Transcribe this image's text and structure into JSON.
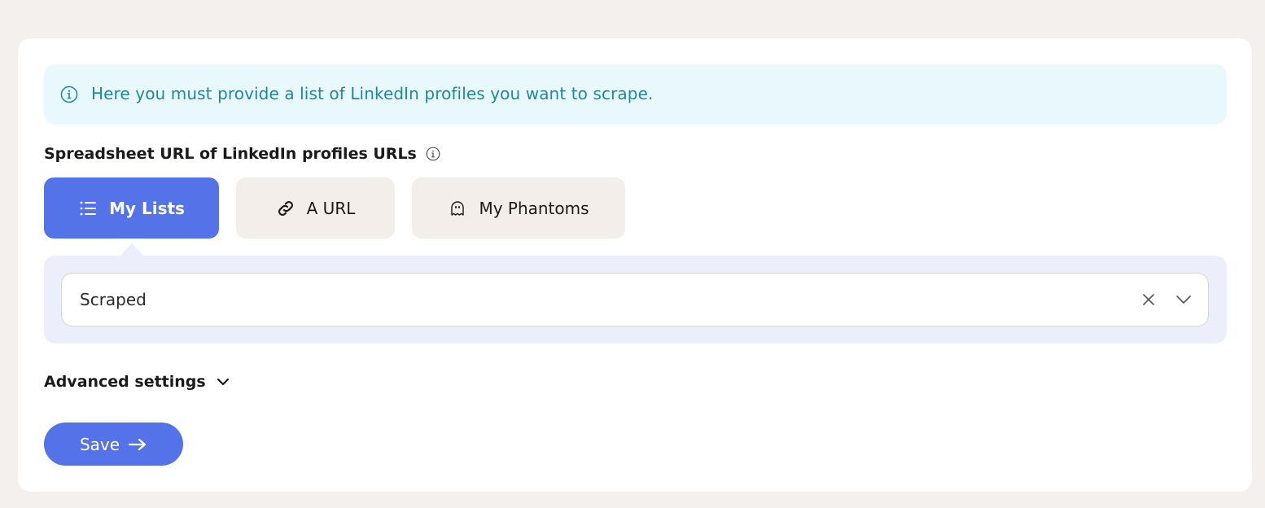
{
  "info_banner": {
    "icon": "info-circle-icon",
    "text": "Here you must provide a list of LinkedIn profiles you want to scrape."
  },
  "field": {
    "label": "Spreadsheet URL of LinkedIn profiles URLs",
    "label_icon": "info-circle-icon"
  },
  "tabs": [
    {
      "label": "My Lists",
      "icon": "list-icon",
      "active": true
    },
    {
      "label": "A URL",
      "icon": "link-icon",
      "active": false
    },
    {
      "label": "My Phantoms",
      "icon": "ghost-icon",
      "active": false
    }
  ],
  "select": {
    "value": "Scraped",
    "clear_icon": "close-icon",
    "dropdown_icon": "chevron-down-icon"
  },
  "advanced": {
    "label": "Advanced settings",
    "icon": "chevron-down-icon"
  },
  "save": {
    "label": "Save",
    "icon": "arrow-right-icon"
  },
  "colors": {
    "accent": "#5573e8",
    "info_bg": "#e8f8fc",
    "info_text": "#1b8aa0",
    "panel_bg": "#eceefb",
    "tab_inactive_bg": "#f3eeea",
    "page_bg": "#f3f0ed"
  }
}
